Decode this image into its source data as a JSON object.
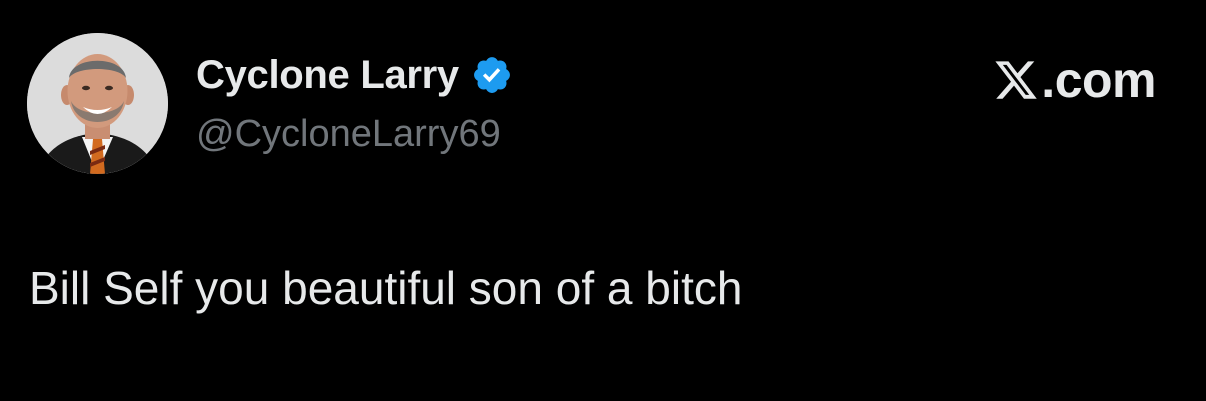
{
  "author": {
    "display_name": "Cyclone Larry",
    "handle": "@CycloneLarry69",
    "verified": true,
    "avatar_icon": "profile-photo"
  },
  "brand": {
    "domain": "X.com",
    "icon": "x-logo-icon"
  },
  "tweet": {
    "text": "Bill Self you beautiful son of a bitch"
  },
  "colors": {
    "background": "#000000",
    "primary_text": "#e7e9ea",
    "secondary_text": "#71767b",
    "verified_blue": "#1d9bf0"
  }
}
